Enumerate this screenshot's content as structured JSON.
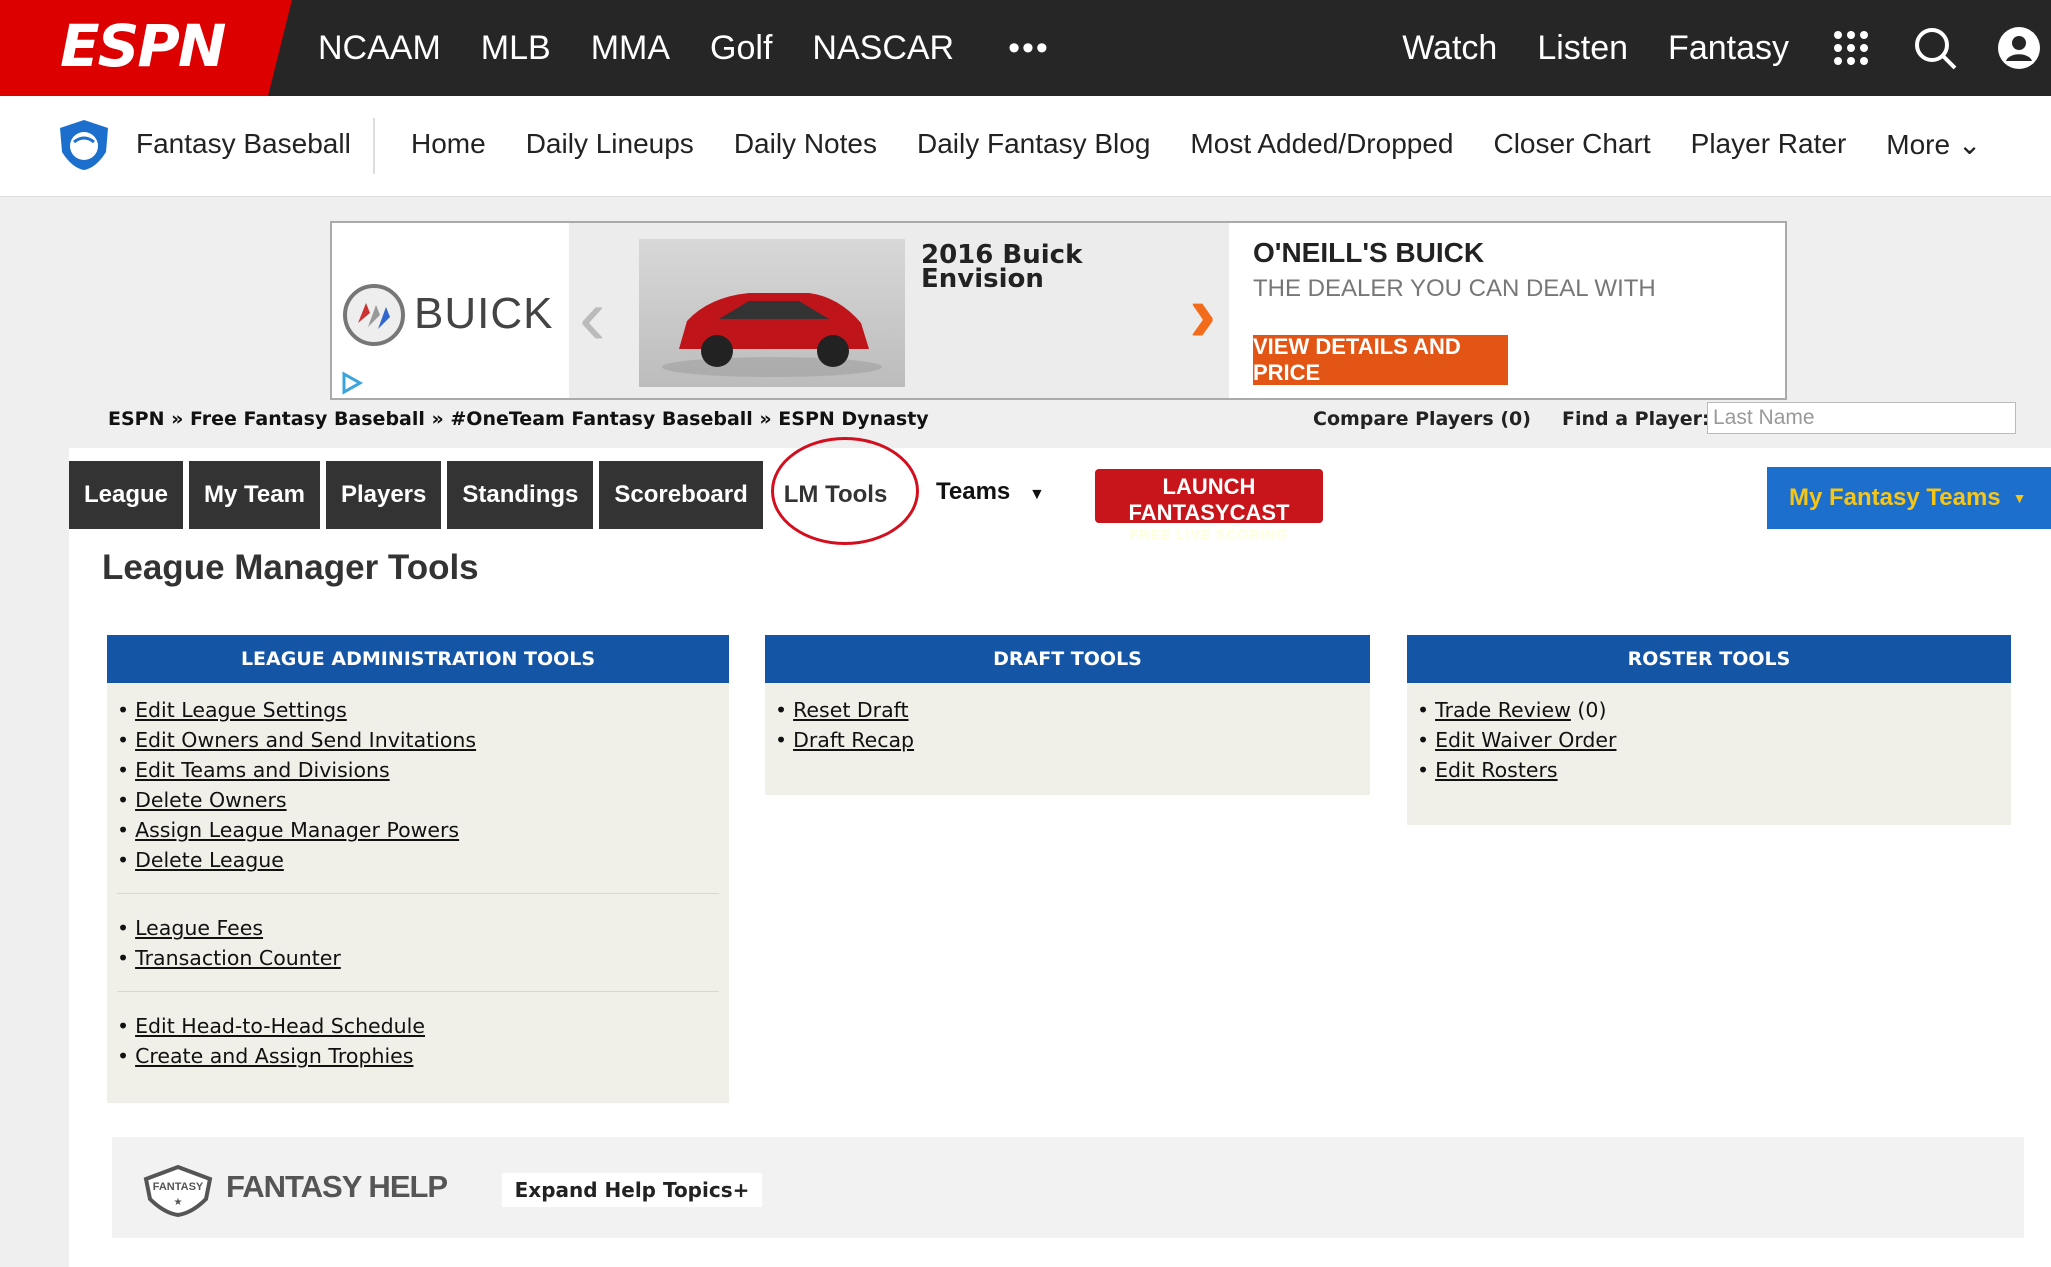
{
  "espn": {
    "logo": "ESPN",
    "nav": [
      "NCAAM",
      "MLB",
      "MMA",
      "Golf",
      "NASCAR"
    ],
    "more_dots": "•••",
    "right_links": [
      "Watch",
      "Listen",
      "Fantasy"
    ]
  },
  "fantasy_bar": {
    "title": "Fantasy Baseball",
    "nav": [
      "Home",
      "Daily Lineups",
      "Daily Notes",
      "Daily Fantasy Blog",
      "Most Added/Dropped",
      "Closer Chart",
      "Player Rater",
      "More ⌄"
    ]
  },
  "ad": {
    "brand": "BUICK",
    "model": "2016 Buick Envision",
    "model_line1": "2016 Buick",
    "model_line2": "Envision",
    "dealer": "O'NEILL'S BUICK",
    "tagline": "THE DEALER YOU CAN DEAL WITH",
    "cta": "VIEW DETAILS AND PRICE"
  },
  "breadcrumb": "ESPN » Free Fantasy Baseball » #OneTeam Fantasy Baseball » ESPN Dynasty",
  "compare_players": "Compare Players (0)",
  "find_player": {
    "label": "Find a Player:",
    "placeholder": "Last Name"
  },
  "tabs": {
    "league": "League",
    "my_team": "My Team",
    "players": "Players",
    "standings": "Standings",
    "scoreboard": "Scoreboard",
    "lm_tools": "LM Tools",
    "teams": "Teams"
  },
  "fantasycast": {
    "line1": "LAUNCH FANTASYCAST",
    "line2": "FREE LIVE SCORING"
  },
  "my_fantasy_teams": "My Fantasy Teams",
  "page_title": "League Manager Tools",
  "sections": {
    "admin": {
      "title": "LEAGUE ADMINISTRATION TOOLS",
      "group1": [
        "Edit League Settings",
        "Edit Owners and Send Invitations",
        "Edit Teams and Divisions",
        "Delete Owners",
        "Assign League Manager Powers",
        "Delete League"
      ],
      "group2": [
        "League Fees",
        "Transaction Counter"
      ],
      "group3": [
        "Edit Head-to-Head Schedule",
        "Create and Assign Trophies"
      ]
    },
    "draft": {
      "title": "DRAFT TOOLS",
      "items": [
        "Reset Draft",
        "Draft Recap"
      ]
    },
    "roster": {
      "title": "ROSTER TOOLS",
      "trade_review": "Trade Review",
      "trade_count": " (0)",
      "items": [
        "Edit Waiver Order",
        "Edit Rosters"
      ]
    }
  },
  "help": {
    "title": "FANTASY HELP",
    "badge": "FANTASY",
    "expand": "Expand Help Topics+"
  },
  "colors": {
    "espn_red": "#dd0000",
    "top_bar": "#262626",
    "section_blue": "#1455a5",
    "my_teams_blue": "#1c6fcd",
    "my_teams_text": "#f5c518",
    "fantasycast_red": "#c8151b",
    "circle_annotation": "#d20f1e"
  }
}
